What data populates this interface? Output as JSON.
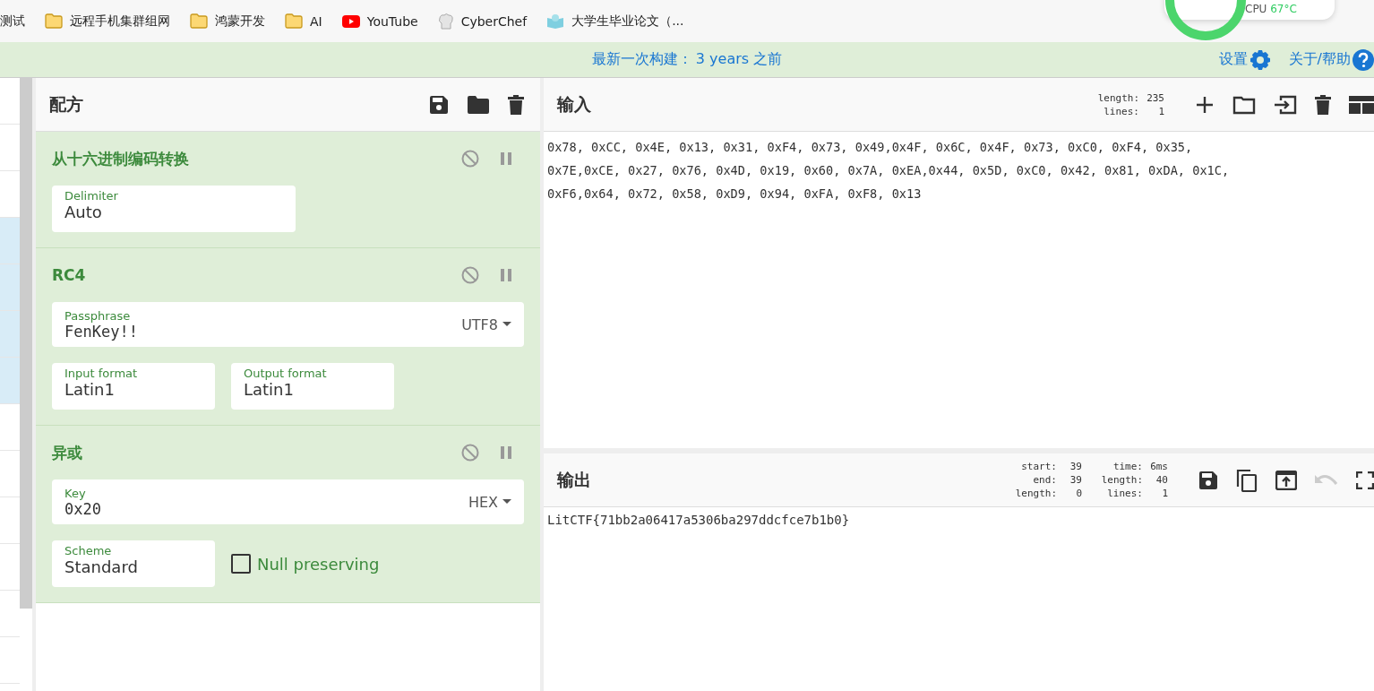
{
  "bookmarks": [
    {
      "kind": "plain",
      "label": "测试"
    },
    {
      "kind": "folder",
      "label": "远程手机集群组网"
    },
    {
      "kind": "folder",
      "label": "鸿蒙开发"
    },
    {
      "kind": "folder",
      "label": "AI"
    },
    {
      "kind": "video",
      "label": "YouTube"
    },
    {
      "kind": "chef",
      "label": "CyberChef"
    },
    {
      "kind": "book",
      "label": "大学生毕业论文（..."
    }
  ],
  "monitor": {
    "cpu_label": "CPU",
    "cpu_temp": "67°C"
  },
  "banner": {
    "text": "最新一次构建：",
    "link": "3 years 之前",
    "settings": "设置",
    "about": "关于/帮助"
  },
  "recipe": {
    "title": "配方",
    "operations": [
      {
        "title": "从十六进制编码转换",
        "args": [
          {
            "kind": "widefield",
            "label": "Delimiter",
            "value": "Auto"
          }
        ]
      },
      {
        "title": "RC4",
        "args": [
          {
            "kind": "toggle",
            "label": "Passphrase",
            "value": "FenKey!!",
            "option": "UTF8"
          },
          {
            "kind": "field",
            "label": "Input format",
            "value": "Latin1"
          },
          {
            "kind": "field",
            "label": "Output format",
            "value": "Latin1"
          }
        ]
      },
      {
        "title": "异或",
        "args": [
          {
            "kind": "toggle",
            "label": "Key",
            "value": "0x20",
            "option": "HEX"
          },
          {
            "kind": "field",
            "label": "Scheme",
            "value": "Standard"
          },
          {
            "kind": "checkbox",
            "label": "Null preserving",
            "checked": false
          }
        ]
      }
    ]
  },
  "input": {
    "title": "输入",
    "stats": [
      [
        "length:",
        "235"
      ],
      [
        "lines:",
        "1"
      ]
    ],
    "lines": [
      "0x78, 0xCC, 0x4E, 0x13, 0x31, 0xF4, 0x73, 0x49,0x4F, 0x6C, 0x4F, 0x73, 0xC0, 0xF4, 0x35,",
      "0x7E,0xCE, 0x27, 0x76, 0x4D, 0x19, 0x60, 0x7A, 0xEA,0x44, 0x5D, 0xC0, 0x42, 0x81, 0xDA, 0x1C,",
      "0xF6,0x64, 0x72, 0x58, 0xD9, 0x94, 0xFA, 0xF8, 0x13"
    ]
  },
  "output": {
    "title": "输出",
    "stats": [
      [
        "start:",
        "39",
        "time:",
        "6ms"
      ],
      [
        "end:",
        "39",
        "length:",
        "40"
      ],
      [
        "length:",
        "0",
        "lines:",
        "1"
      ]
    ],
    "text": "LitCTF{71bb2a06417a5306ba297ddcfce7b1b0}"
  }
}
